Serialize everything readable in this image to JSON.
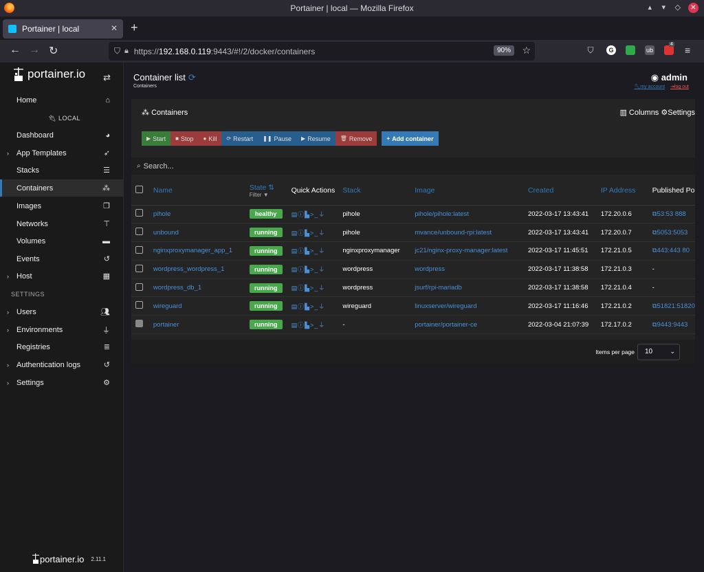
{
  "window": {
    "title": "Portainer | local — Mozilla Firefox"
  },
  "browser": {
    "tab_title": "Portainer | local",
    "url_prefix": "https://",
    "url_host": "192.168.0.119",
    "url_rest": ":9443/#!/2/docker/containers",
    "zoom": "90%",
    "ext_badge": "4"
  },
  "sidebar": {
    "brand": "portainer.io",
    "env_label": "LOCAL",
    "items": [
      {
        "label": "Home",
        "icon": "home-icon"
      },
      {
        "label": "Dashboard",
        "icon": "tachometer-icon"
      },
      {
        "label": "App Templates",
        "icon": "rocket-icon"
      },
      {
        "label": "Stacks",
        "icon": "list-icon"
      },
      {
        "label": "Containers",
        "icon": "cubes-icon"
      },
      {
        "label": "Images",
        "icon": "clone-icon"
      },
      {
        "label": "Networks",
        "icon": "sitemap-icon"
      },
      {
        "label": "Volumes",
        "icon": "hdd-icon"
      },
      {
        "label": "Events",
        "icon": "history-icon"
      },
      {
        "label": "Host",
        "icon": "th-icon"
      }
    ],
    "settings_header": "SETTINGS",
    "settings_items": [
      {
        "label": "Users",
        "icon": "users-icon"
      },
      {
        "label": "Environments",
        "icon": "plug-icon"
      },
      {
        "label": "Registries",
        "icon": "database-icon"
      },
      {
        "label": "Authentication logs",
        "icon": "history-icon"
      },
      {
        "label": "Settings",
        "icon": "cogs-icon"
      }
    ],
    "footer_brand": "portainer.io",
    "footer_version": "2.11.1"
  },
  "header": {
    "title": "Container list",
    "breadcrumb": "Containers",
    "user": "admin",
    "my_account": "my account",
    "log_out": "log out"
  },
  "panel": {
    "title": "Containers",
    "columns_label": "Columns",
    "settings_label": "Settings",
    "search_placeholder": "Search...",
    "items_per_page_label": "Items per page",
    "items_per_page_value": "10"
  },
  "actions": [
    {
      "label": "Start",
      "color": "#3a7d3a"
    },
    {
      "label": "Stop",
      "color": "#9c3b3b"
    },
    {
      "label": "Kill",
      "color": "#9c3b3b"
    },
    {
      "label": "Restart",
      "color": "#285e8e"
    },
    {
      "label": "Pause",
      "color": "#285e8e"
    },
    {
      "label": "Resume",
      "color": "#285e8e"
    },
    {
      "label": "Remove",
      "color": "#9c3b3b"
    }
  ],
  "add_container_label": "Add container",
  "columns": {
    "name": "Name",
    "state": "State",
    "state_filter": "Filter",
    "quick_actions": "Quick Actions",
    "stack": "Stack",
    "image": "Image",
    "created": "Created",
    "ip": "IP Address",
    "published": "Published Po"
  },
  "rows": [
    {
      "name": "pihole",
      "state": "healthy",
      "stack": "pihole",
      "image": "pihole/pihole:latest",
      "created": "2022-03-17 13:43:41",
      "ip": "172.20.0.6",
      "ports": "53:53 888"
    },
    {
      "name": "unbound",
      "state": "running",
      "stack": "pihole",
      "image": "mvance/unbound-rpi:latest",
      "created": "2022-03-17 13:43:41",
      "ip": "172.20.0.7",
      "ports": "5053:5053"
    },
    {
      "name": "nginxproxymanager_app_1",
      "state": "running",
      "stack": "nginxproxymanager",
      "image": "jc21/nginx-proxy-manager:latest",
      "created": "2022-03-17 11:45:51",
      "ip": "172.21.0.5",
      "ports": "443:443 80"
    },
    {
      "name": "wordpress_wordpress_1",
      "state": "running",
      "stack": "wordpress",
      "image": "wordpress",
      "created": "2022-03-17 11:38:58",
      "ip": "172.21.0.3",
      "ports": "-"
    },
    {
      "name": "wordpress_db_1",
      "state": "running",
      "stack": "wordpress",
      "image": "jsurf/rpi-mariadb",
      "created": "2022-03-17 11:38:58",
      "ip": "172.21.0.4",
      "ports": "-"
    },
    {
      "name": "wireguard",
      "state": "running",
      "stack": "wireguard",
      "image": "linuxserver/wireguard",
      "created": "2022-03-17 11:16:46",
      "ip": "172.21.0.2",
      "ports": "51821:51820"
    },
    {
      "name": "portainer",
      "state": "running",
      "stack": "-",
      "image": "portainer/portainer-ce",
      "created": "2022-03-04 21:07:39",
      "ip": "172.17.0.2",
      "ports": "9443:9443"
    }
  ]
}
